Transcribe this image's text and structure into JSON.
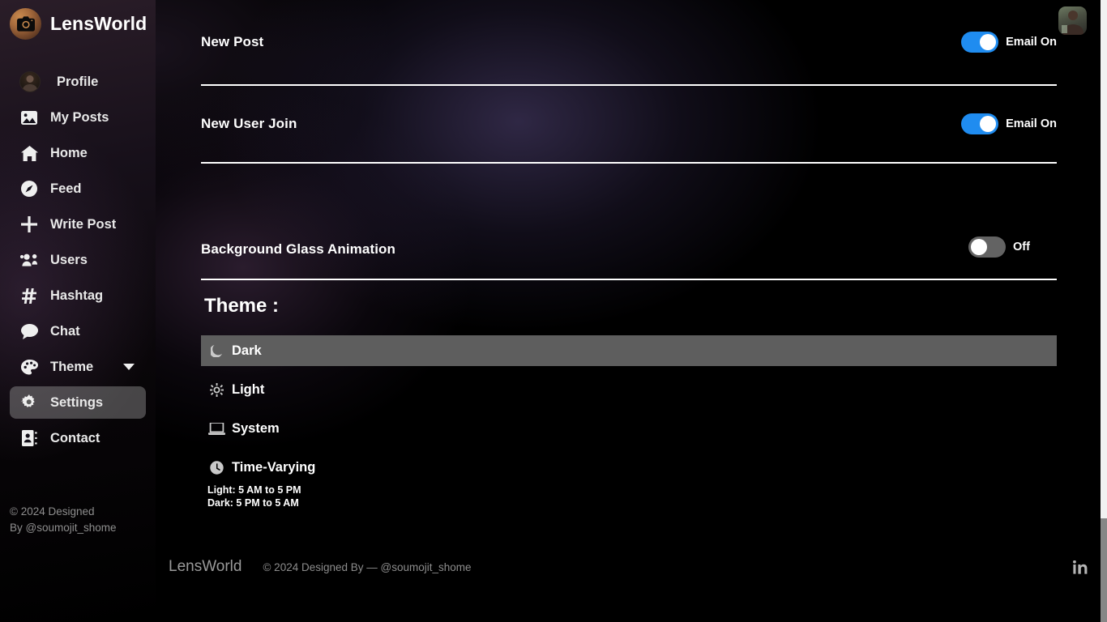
{
  "brand": {
    "name": "LensWorld",
    "logo_icon": "camera-icon"
  },
  "sidebar": {
    "items": [
      {
        "label": "Profile",
        "icon": "user-avatar-icon"
      },
      {
        "label": "My Posts",
        "icon": "image-icon"
      },
      {
        "label": "Home",
        "icon": "home-icon"
      },
      {
        "label": "Feed",
        "icon": "compass-icon"
      },
      {
        "label": "Write Post",
        "icon": "plus-icon"
      },
      {
        "label": "Users",
        "icon": "users-icon"
      },
      {
        "label": "Hashtag",
        "icon": "hashtag-icon"
      },
      {
        "label": "Chat",
        "icon": "chat-bubble-icon"
      },
      {
        "label": "Theme",
        "icon": "palette-icon",
        "caret": "chevron-down-icon"
      },
      {
        "label": "Settings",
        "icon": "gear-icon",
        "active": true
      },
      {
        "label": "Contact",
        "icon": "contact-book-icon"
      }
    ],
    "copyright_line1": "© 2024 Designed",
    "copyright_line2": "By @soumojit_shome"
  },
  "settings": {
    "rows": [
      {
        "label": "New Post",
        "state": "Email On",
        "on": true
      },
      {
        "label": "New User Join",
        "state": "Email On",
        "on": true
      },
      {
        "label": "Background Glass Animation",
        "state": "Off",
        "on": false
      }
    ]
  },
  "theme": {
    "title": "Theme :",
    "options": [
      {
        "label": "Dark",
        "icon": "moon-icon",
        "selected": true
      },
      {
        "label": "Light",
        "icon": "sun-icon",
        "selected": false
      },
      {
        "label": "System",
        "icon": "laptop-icon",
        "selected": false
      },
      {
        "label": "Time-Varying",
        "icon": "clock-icon",
        "selected": false,
        "sub_line1": "Light: 5 AM to 5 PM",
        "sub_line2": "Dark: 5 PM to 5 AM"
      }
    ]
  },
  "footer": {
    "brand": "LensWorld",
    "copyright": "© 2024 Designed By — @soumojit_shome",
    "social_icon": "linkedin-icon"
  },
  "topbar": {
    "avatar_icon": "user-avatar"
  },
  "colors": {
    "toggle_on": "#1f8cf0",
    "toggle_off": "#636363",
    "selected_row": "#5e5e5e",
    "sidebar_active": "rgba(160,160,160,0.42)",
    "divider": "#ffffff"
  }
}
